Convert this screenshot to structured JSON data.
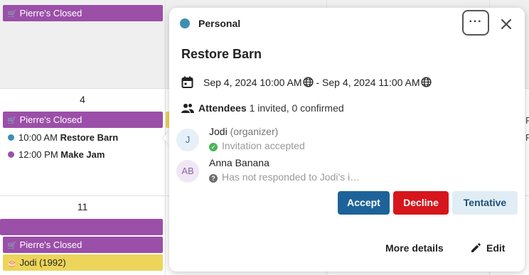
{
  "calendar": {
    "day_4": "4",
    "day_11": "11",
    "events": {
      "pierre_closed": "Pierre's Closed",
      "restore_barn_time": "10:00 AM",
      "restore_barn_title": "Restore Barn",
      "make_jam_time": "12:00 PM",
      "make_jam_title": "Make Jam",
      "jodi_birthday": "Jodi (1992)"
    },
    "colors": {
      "purple_event": "#9b4fa8",
      "yellow_event": "#ecd55a",
      "blue_dot": "#3c8fb1"
    },
    "edge_text_top": "F",
    "edge_text_bottom": "F"
  },
  "popover": {
    "calendar_name": "Personal",
    "calendar_color": "#3c8fb1",
    "more_label": "···",
    "close_label": "×",
    "title": "Restore Barn",
    "start": "Sep 4, 2024 10:00 AM",
    "separator": "-",
    "end": "Sep 4, 2024 11:00 AM",
    "attendees_label": "Attendees",
    "attendees_summary": "1 invited, 0 confirmed",
    "attendees": [
      {
        "initials": "J",
        "name": "Jodi",
        "role": "(organizer)",
        "status": "Invitation accepted"
      },
      {
        "initials": "AB",
        "name": "Anna Banana",
        "role": "",
        "status": "Has not responded to Jodi's i…"
      }
    ],
    "buttons": {
      "accept": "Accept",
      "decline": "Decline",
      "tentative": "Tentative"
    },
    "more_details": "More details",
    "edit": "Edit",
    "accent_colors": {
      "accept": "#1d6399",
      "decline": "#d7151c",
      "tentative": "#e1edf5"
    }
  }
}
